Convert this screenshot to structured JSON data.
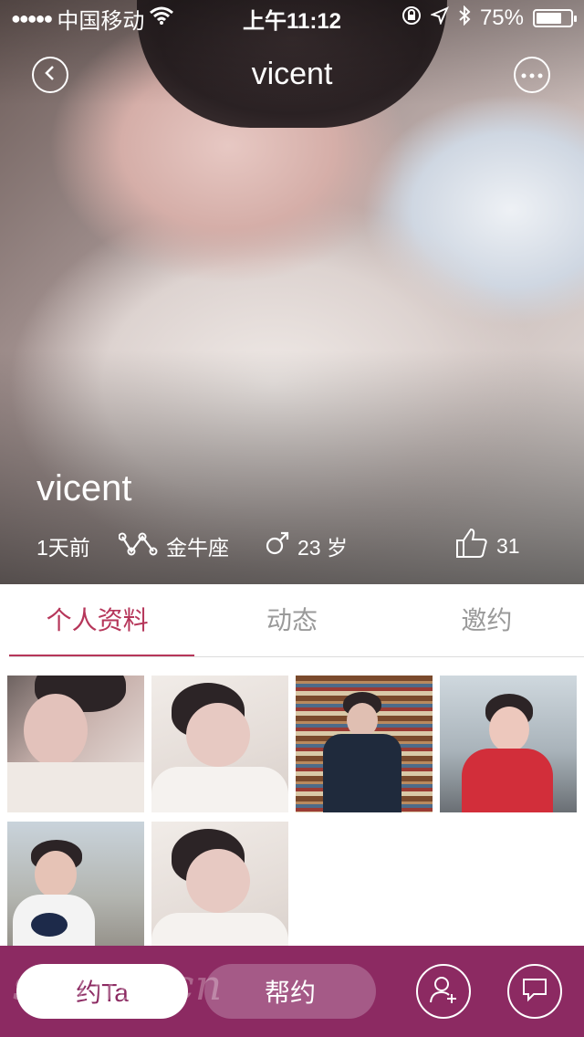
{
  "status_bar": {
    "signal": "●●●●●",
    "carrier": "中国移动",
    "time": "上午11:12",
    "battery": "75%",
    "battery_level": 0.75
  },
  "header": {
    "title": "vicent",
    "back_icon": "chevron-left-icon",
    "more_icon": "ellipsis-icon"
  },
  "profile": {
    "name": "vicent",
    "last_seen": "1天前",
    "zodiac": "金牛座",
    "gender": "male",
    "age": "23 岁",
    "likes": "31"
  },
  "tabs": [
    {
      "label": "个人资料",
      "active": true
    },
    {
      "label": "动态",
      "active": false
    },
    {
      "label": "邀约",
      "active": false
    }
  ],
  "gallery": {
    "photos": [
      {
        "scene": "portrait-close"
      },
      {
        "scene": "sleeping"
      },
      {
        "scene": "bookshelf"
      },
      {
        "scene": "street-selfie"
      },
      {
        "scene": "city-view"
      },
      {
        "scene": "sleeping"
      }
    ]
  },
  "bottom_bar": {
    "date_button": "约Ta",
    "help_button": "帮约",
    "follow_icon": "add-user-icon",
    "chat_icon": "chat-bubble-icon",
    "watermark": "sstime.cn"
  },
  "colors": {
    "accent": "#b6365a",
    "bottom_bar": "#8c2a62",
    "help_button": "#a55a87"
  }
}
